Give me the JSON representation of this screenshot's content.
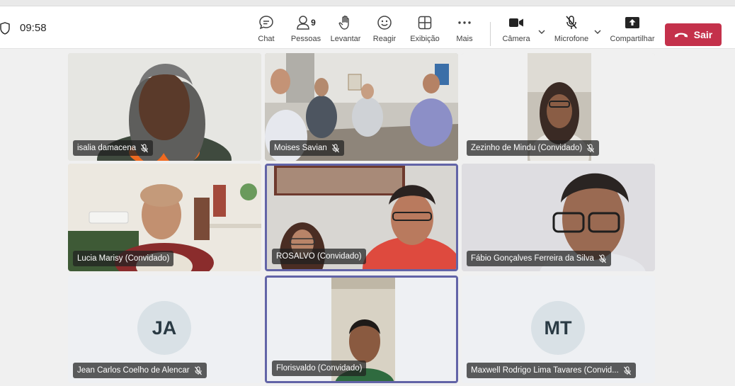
{
  "header": {
    "time": "09:58",
    "buttons": {
      "chat": "Chat",
      "people": "Pessoas",
      "people_count": "9",
      "raise": "Levantar",
      "react": "Reagir",
      "view": "Exibição",
      "more": "Mais",
      "camera": "Câmera",
      "mic": "Microfone",
      "share": "Compartilhar",
      "leave": "Sair"
    },
    "leave_color": "#c4314b"
  },
  "participants": [
    {
      "name": "isalia damacena",
      "muted": true,
      "video": true
    },
    {
      "name": "Moises Savian",
      "muted": true,
      "video": true
    },
    {
      "name": "Zezinho de Mindu (Convidado)",
      "muted": true,
      "video": true
    },
    {
      "name": "Lucia Marisy (Convidado)",
      "muted": false,
      "video": true
    },
    {
      "name": "ROSALVO (Convidado)",
      "muted": false,
      "video": true,
      "speaking": true
    },
    {
      "name": "Fábio Gonçalves Ferreira da Silva",
      "muted": true,
      "video": true
    },
    {
      "name": "Jean Carlos Coelho de Alencar",
      "muted": true,
      "video": false,
      "initials": "JA"
    },
    {
      "name": "Florisvaldo (Convidado)",
      "muted": false,
      "video": true,
      "speaking": true
    },
    {
      "name": "Maxwell Rodrigo Lima Tavares (Convid...",
      "muted": true,
      "video": false,
      "initials": "MT"
    }
  ],
  "accent_color": "#6264a7"
}
